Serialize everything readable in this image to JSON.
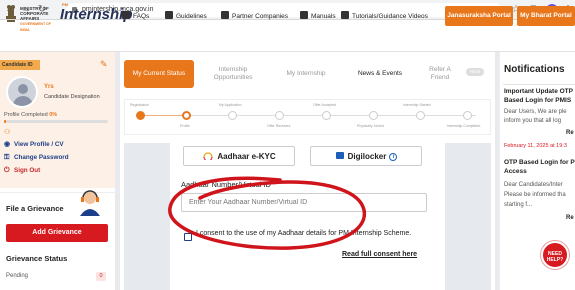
{
  "browser": {
    "url": "pmintership.mca.gov.in",
    "lock_icon": "lock-icon"
  },
  "header": {
    "ministry": "MINISTRY OF CORPORATE AFFAIRS",
    "ministry_sub": "GOVERNMENT OF INDIA",
    "logo_prefix": "PM",
    "logo": "Internship",
    "nav": [
      {
        "label": "FAQs",
        "icon": "faq-icon"
      },
      {
        "label": "Guidelines",
        "icon": "guidelines-icon"
      },
      {
        "label": "Partner Companies",
        "icon": "companies-icon"
      },
      {
        "label": "Manuals",
        "icon": "manuals-icon"
      },
      {
        "label": "Tutorials/Guidance Videos",
        "icon": "video-icon"
      }
    ],
    "btn_janasuraksha": "Janasuraksha Portal",
    "btn_bharat": "My Bharat Portal"
  },
  "sidebar": {
    "candidate_id_label": "Candidate ID",
    "name": "Yrs",
    "designation": "Candidate Designation",
    "profile_completed_label": "Profile Completed",
    "profile_completed_pct": "0%",
    "profile_progress": 0.02,
    "links": [
      {
        "label": "View Profile / CV",
        "icon": "eye-icon"
      },
      {
        "label": "Change Password",
        "icon": "key-icon"
      },
      {
        "label": "Sign Out",
        "icon": "power-icon"
      }
    ],
    "grievance_title": "File a Grievance",
    "add_grievance": "Add Grievance",
    "grievance_status_title": "Grievance Status",
    "pending_label": "Pending",
    "pending_count": "0"
  },
  "tabs": [
    {
      "label": "My Current Status",
      "active": true
    },
    {
      "label": "Internship Opportunities",
      "active": false
    },
    {
      "label": "My Internship",
      "active": false
    },
    {
      "label": "News & Events",
      "active": false
    },
    {
      "label": "Refer A Friend",
      "active": false
    }
  ],
  "new_badge": "NEW",
  "stepper": {
    "top_labels": [
      "Registration",
      "My Application",
      "Offer Accepted",
      "Internship Started"
    ],
    "bottom_labels": [
      "Profile",
      "Offer Received",
      "Physically Joined",
      "Internship Completed"
    ]
  },
  "kyc": {
    "aadhaar_ekyc": "Aadhaar e-KYC",
    "digilocker": "Digilocker",
    "aadhaar_label": "Aadhaar Number/Virtual ID",
    "aadhaar_required": "*",
    "aadhaar_placeholder": "Enter Your Aadhaar Number/Virtual ID",
    "consent": "I consent to the use of my Aadhaar details for PM Internship Scheme.",
    "read_consent": "Read full consent here"
  },
  "notifications": {
    "title": "Notifications",
    "items": [
      {
        "title1": "Important Update OTP",
        "title2": "Based Login for PMIS",
        "body1": "Dear Users, We are ple",
        "body2": "inform you that all log",
        "read_more": "Re"
      },
      {
        "date": "February 11, 2025 at 19:3"
      },
      {
        "title1": "OTP Based Login for P",
        "title2": "Access",
        "body1": "Dear Candidates/Inter",
        "body2": "Please be informed tha",
        "body3": "starting f...",
        "read_more": "Re"
      }
    ],
    "need_help": "NEED HELP?"
  },
  "colors": {
    "accent": "#e8771c",
    "primary_red": "#d71920",
    "link_blue": "#1d3f8a",
    "annotation_red": "#d0141c"
  }
}
